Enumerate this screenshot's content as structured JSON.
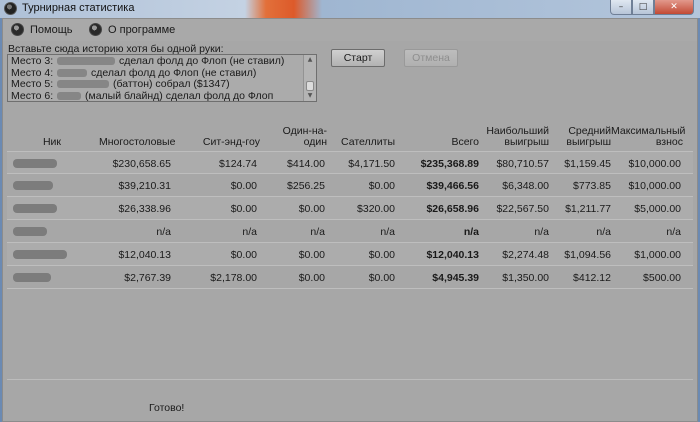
{
  "window": {
    "title": "Турнирная статистика",
    "controls": {
      "minimize": "–",
      "maximize": "□",
      "close": "✕"
    }
  },
  "menu": {
    "items": [
      {
        "label": "Помощь",
        "icon": "help-icon"
      },
      {
        "label": "О программе",
        "icon": "info-icon"
      }
    ]
  },
  "history": {
    "label": "Вставьте сюда историю хотя бы одной руки:",
    "lines": [
      {
        "prefix": "Место 3: ",
        "suffix": " сделал фолд до Флоп (не ставил)"
      },
      {
        "prefix": "Место 4: ",
        "suffix": " сделал фолд до Флоп (не ставил)"
      },
      {
        "prefix": "Место 5: ",
        "suffix": " (баттон) собрал ($1347)"
      },
      {
        "prefix": "Место 6: ",
        "suffix": " (малый блайнд) сделал фолд до Флоп"
      }
    ]
  },
  "buttons": {
    "start": "Старт",
    "cancel": "Отмена"
  },
  "table": {
    "columns": [
      "Ник",
      "Многостоловые",
      "Сит-энд-гоу",
      "Один-на-один",
      "Сателлиты",
      "Всего",
      "Наибольший выигрыш",
      "Средний выигрыш",
      "Максимальный взнос"
    ],
    "rows": [
      {
        "nick": "h8ok",
        "cells": [
          "$230,658.65",
          "$124.74",
          "$414.00",
          "$4,171.50",
          "$235,368.89",
          "$80,710.57",
          "$1,159.45",
          "$10,000.00"
        ]
      },
      {
        "nick": "s______",
        "cells": [
          "$39,210.31",
          "$0.00",
          "$256.25",
          "$0.00",
          "$39,466.56",
          "$6,348.00",
          "$773.85",
          "$10,000.00"
        ]
      },
      {
        "nick": "T______",
        "cells": [
          "$26,338.96",
          "$0.00",
          "$0.00",
          "$320.00",
          "$26,658.96",
          "$22,567.50",
          "$1,211.77",
          "$5,000.00"
        ]
      },
      {
        "nick": "A___M83",
        "cells": [
          "n/a",
          "n/a",
          "n/a",
          "n/a",
          "n/a",
          "n/a",
          "n/a",
          "n/a"
        ]
      },
      {
        "nick": "______yan",
        "cells": [
          "$12,040.13",
          "$0.00",
          "$0.00",
          "$0.00",
          "$12,040.13",
          "$2,274.48",
          "$1,094.56",
          "$1,000.00"
        ]
      },
      {
        "nick": "d______",
        "cells": [
          "$2,767.39",
          "$2,178.00",
          "$0.00",
          "$0.00",
          "$4,945.39",
          "$1,350.00",
          "$412.12",
          "$500.00"
        ]
      }
    ]
  },
  "status": "Готово!"
}
